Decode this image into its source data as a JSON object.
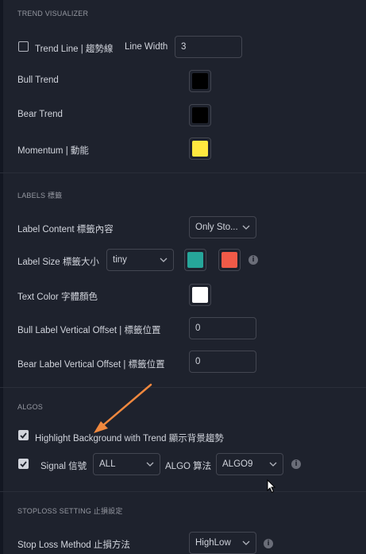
{
  "colors": {
    "background": "#1e222d",
    "border": "#434651",
    "bull_trend": "#000000",
    "bear_trend": "#000000",
    "momentum": "#ffe83f",
    "label_color_1": "#26a69a",
    "label_color_2": "#f05a48",
    "text_color": "#ffffff",
    "arrow": "#f0883e"
  },
  "trend_visualizer": {
    "section_title": "TREND VISUALIZER",
    "trend_line_label": "Trend Line | 趨勢線",
    "trend_line_checked": false,
    "line_width_label": "Line Width",
    "line_width_value": "3",
    "bull_trend_label": "Bull Trend",
    "bear_trend_label": "Bear Trend",
    "momentum_label": "Momentum | 動能"
  },
  "labels": {
    "section_title": "LABELS 標籤",
    "label_content_label": "Label Content 標籤內容",
    "label_content_value": "Only Sto...",
    "label_size_label": "Label Size 標籤大小",
    "label_size_value": "tiny",
    "text_color_label": "Text Color 字體顏色",
    "bull_offset_label": "Bull Label Vertical Offset | 標籤位置",
    "bull_offset_value": "0",
    "bear_offset_label": "Bear Label Vertical Offset | 標籤位置",
    "bear_offset_value": "0"
  },
  "algos": {
    "section_title": "ALGOS",
    "highlight_label": "Highlight Background with Trend 顯示背景趨勢",
    "highlight_checked": true,
    "signal_label": "Signal 信號",
    "signal_checked": true,
    "signal_value": "ALL",
    "algo_label": "ALGO 算法",
    "algo_value": "ALGO9"
  },
  "stoploss": {
    "section_title": "STOPLOSS SETTING 止損設定",
    "method_label": "Stop Loss Method 止損方法",
    "method_value": "HighLow"
  },
  "icons": {
    "info": "i",
    "chevron": "chevron-down-icon",
    "check": "check-icon"
  }
}
